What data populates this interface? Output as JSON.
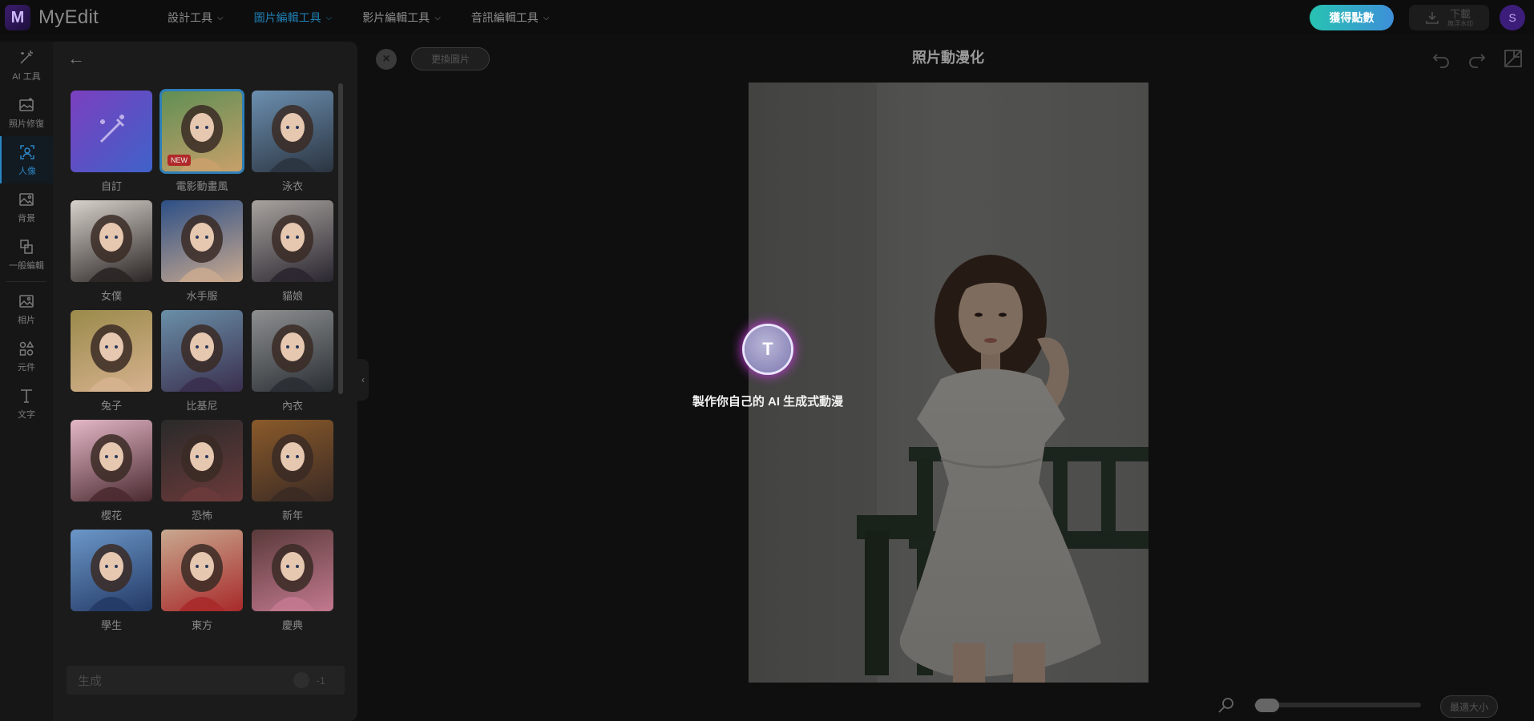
{
  "app": {
    "logo_letter": "M",
    "name": "MyEdit"
  },
  "nav": [
    {
      "label": "設計工具",
      "active": false
    },
    {
      "label": "圖片編輯工具",
      "active": true
    },
    {
      "label": "影片編輯工具",
      "active": false
    },
    {
      "label": "音訊編輯工具",
      "active": false
    }
  ],
  "header": {
    "points_label": "獲得點數",
    "download_label": "下載",
    "download_sub": "無浮水印",
    "avatar_letter": "S"
  },
  "rail": [
    {
      "label": "AI 工具",
      "icon": "magic-wand-icon",
      "active": false
    },
    {
      "label": "照片修復",
      "icon": "photo-repair-icon",
      "active": false
    },
    {
      "label": "人像",
      "icon": "portrait-icon",
      "active": true
    },
    {
      "label": "背景",
      "icon": "background-icon",
      "active": false
    },
    {
      "label": "一般編輯",
      "icon": "crop-icon",
      "active": false
    },
    {
      "label": "相片",
      "icon": "image-icon",
      "active": false
    },
    {
      "label": "元件",
      "icon": "shapes-icon",
      "active": false
    },
    {
      "label": "文字",
      "icon": "text-icon",
      "active": false
    }
  ],
  "styles": [
    {
      "label": "自訂",
      "selected": false,
      "badge": ""
    },
    {
      "label": "電影動畫風",
      "selected": true,
      "badge": "NEW"
    },
    {
      "label": "泳衣",
      "selected": false,
      "badge": ""
    },
    {
      "label": "女僕",
      "selected": false,
      "badge": ""
    },
    {
      "label": "水手服",
      "selected": false,
      "badge": ""
    },
    {
      "label": "貓娘",
      "selected": false,
      "badge": ""
    },
    {
      "label": "兔子",
      "selected": false,
      "badge": ""
    },
    {
      "label": "比基尼",
      "selected": false,
      "badge": ""
    },
    {
      "label": "內衣",
      "selected": false,
      "badge": ""
    },
    {
      "label": "櫻花",
      "selected": false,
      "badge": ""
    },
    {
      "label": "恐怖",
      "selected": false,
      "badge": ""
    },
    {
      "label": "新年",
      "selected": false,
      "badge": ""
    },
    {
      "label": "學生",
      "selected": false,
      "badge": ""
    },
    {
      "label": "東方",
      "selected": false,
      "badge": ""
    },
    {
      "label": "慶典",
      "selected": false,
      "badge": ""
    }
  ],
  "generate": {
    "label": "生成",
    "cost": "-1"
  },
  "editor": {
    "replace_label": "更換圖片",
    "title": "照片動漫化",
    "loading_letter": "T",
    "loading_text": "製作你自己的 AI 生成式動漫",
    "fit_label": "最適大小",
    "zoom": 0
  }
}
